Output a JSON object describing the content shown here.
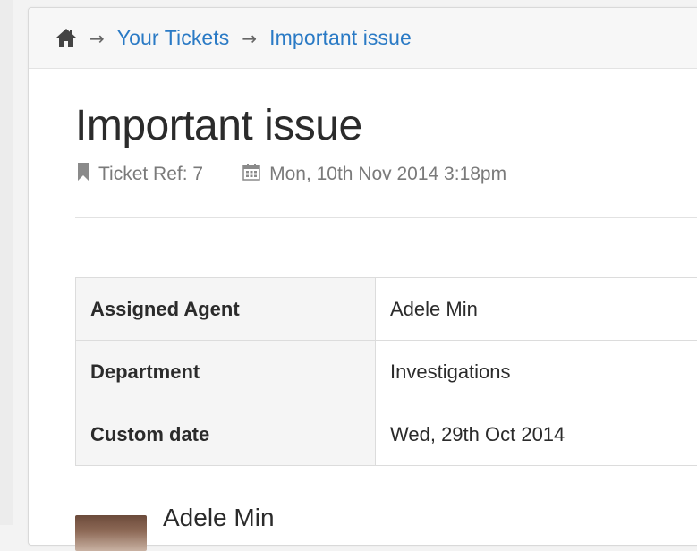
{
  "breadcrumb": {
    "home_icon": "home-icon",
    "separator": "→",
    "items": [
      {
        "label": "Your Tickets"
      },
      {
        "label": "Important issue"
      }
    ]
  },
  "ticket": {
    "title": "Important issue",
    "ref_label": "Ticket Ref: 7",
    "date_label": "Mon, 10th Nov 2014 3:18pm"
  },
  "details": [
    {
      "label": "Assigned Agent",
      "value": "Adele Min"
    },
    {
      "label": "Department",
      "value": "Investigations"
    },
    {
      "label": "Custom date",
      "value": "Wed, 29th Oct 2014"
    }
  ],
  "author": {
    "name": "Adele Min"
  },
  "colors": {
    "link": "#2a7ac5",
    "text": "#2b2b2b",
    "muted": "#7a7a7a"
  }
}
